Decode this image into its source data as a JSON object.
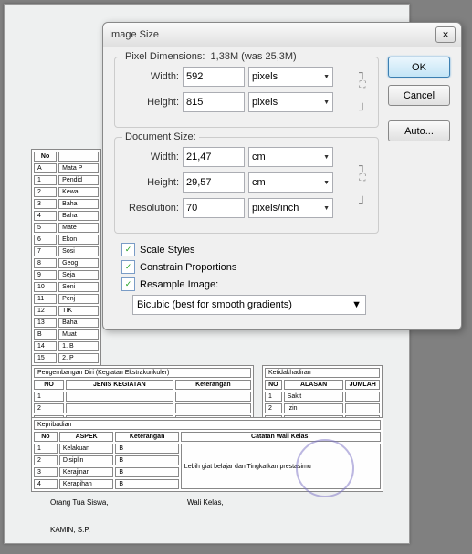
{
  "dialog": {
    "title": "Image Size",
    "pixel": {
      "legend": "Pixel Dimensions:",
      "size": "1,38M (was 25,3M)",
      "wlabel": "Width:",
      "wval": "592",
      "hlabel": "Height:",
      "hval": "815",
      "unit": "pixels"
    },
    "doc": {
      "legend": "Document Size:",
      "wlabel": "Width:",
      "wval": "21,47",
      "hlabel": "Height:",
      "hval": "29,57",
      "unit": "cm",
      "rlabel": "Resolution:",
      "rval": "70",
      "runit": "pixels/inch"
    },
    "scale": "Scale Styles",
    "constrain": "Constrain Proportions",
    "resample": "Resample Image:",
    "resample_method": "Bicubic (best for smooth gradients)",
    "ok": "OK",
    "cancel": "Cancel",
    "auto": "Auto..."
  }
}
